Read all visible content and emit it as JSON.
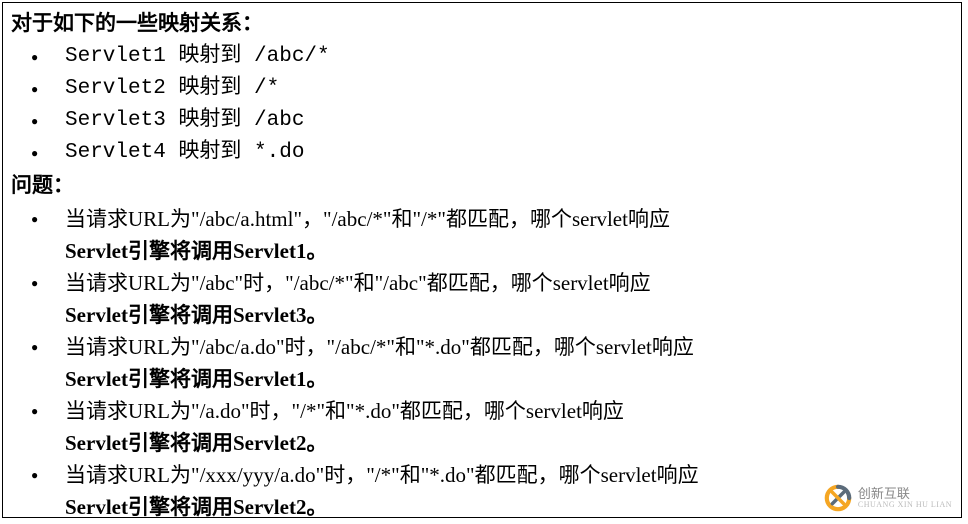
{
  "heading1": "对于如下的一些映射关系：",
  "mappings": [
    "Servlet1 映射到 /abc/*",
    "Servlet2 映射到 /*",
    "Servlet3 映射到 /abc",
    "Servlet4 映射到 *.do"
  ],
  "heading2": "问题：",
  "questions": [
    {
      "q": "当请求URL为\"/abc/a.html\"，\"/abc/*\"和\"/*\"都匹配，哪个servlet响应",
      "a": "Servlet引擎将调用Servlet1。"
    },
    {
      "q": "当请求URL为\"/abc\"时，\"/abc/*\"和\"/abc\"都匹配，哪个servlet响应",
      "a": "Servlet引擎将调用Servlet3。"
    },
    {
      "q": "当请求URL为\"/abc/a.do\"时，\"/abc/*\"和\"*.do\"都匹配，哪个servlet响应",
      "a": "Servlet引擎将调用Servlet1。"
    },
    {
      "q": "当请求URL为\"/a.do\"时，\"/*\"和\"*.do\"都匹配，哪个servlet响应",
      "a": "Servlet引擎将调用Servlet2。"
    },
    {
      "q": "当请求URL为\"/xxx/yyy/a.do\"时，\"/*\"和\"*.do\"都匹配，哪个servlet响应",
      "a": "Servlet引擎将调用Servlet2。"
    }
  ],
  "watermark": {
    "main": "创新互联",
    "sub": "CHUANG XIN HU LIAN"
  }
}
